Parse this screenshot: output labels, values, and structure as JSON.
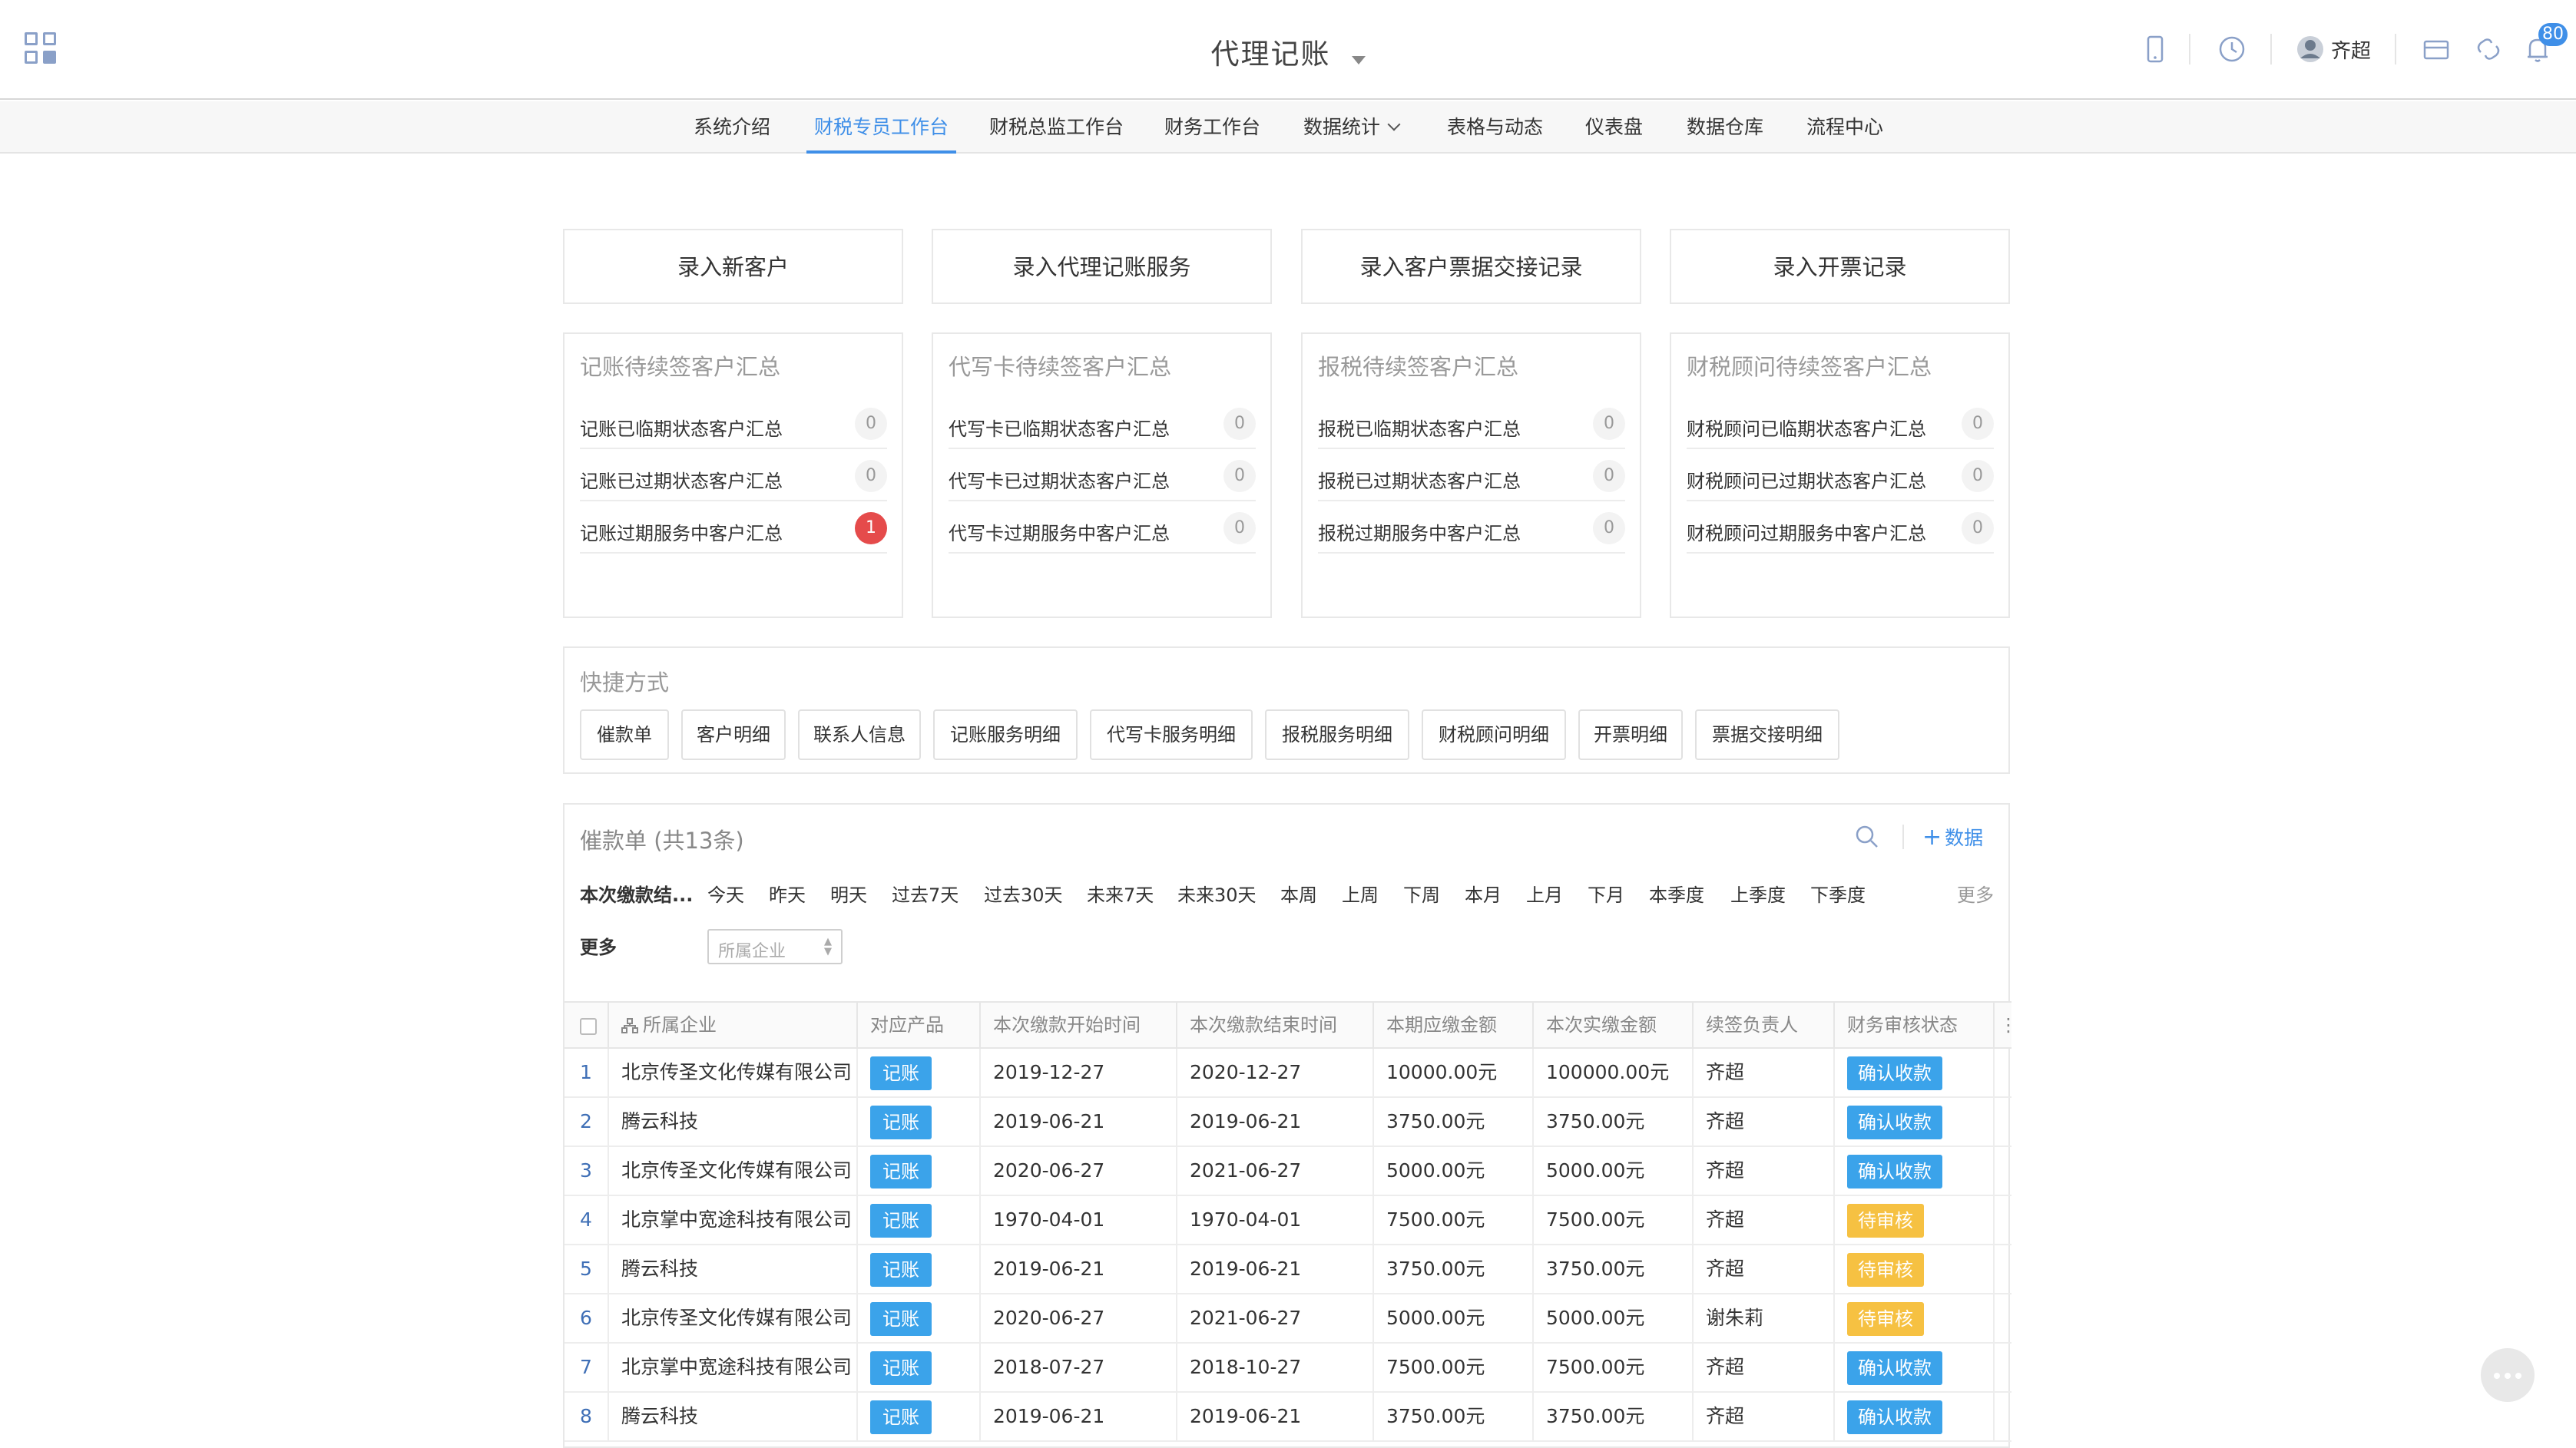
{
  "header": {
    "title": "代理记账",
    "user_name": "齐超",
    "notification_count": "80"
  },
  "nav": {
    "items": [
      "系统介绍",
      "财税专员工作台",
      "财税总监工作台",
      "财务工作台",
      "数据统计",
      "表格与动态",
      "仪表盘",
      "数据仓库",
      "流程中心"
    ],
    "active_index": 1
  },
  "actions": [
    "录入新客户",
    "录入代理记账服务",
    "录入客户票据交接记录",
    "录入开票记录"
  ],
  "summaries": [
    {
      "title": "记账待续签客户汇总",
      "rows": [
        {
          "label": "记账已临期状态客户汇总",
          "count": "0"
        },
        {
          "label": "记账已过期状态客户汇总",
          "count": "0"
        },
        {
          "label": "记账过期服务中客户汇总",
          "count": "1"
        }
      ]
    },
    {
      "title": "代写卡待续签客户汇总",
      "rows": [
        {
          "label": "代写卡已临期状态客户汇总",
          "count": "0"
        },
        {
          "label": "代写卡已过期状态客户汇总",
          "count": "0"
        },
        {
          "label": "代写卡过期服务中客户汇总",
          "count": "0"
        }
      ]
    },
    {
      "title": "报税待续签客户汇总",
      "rows": [
        {
          "label": "报税已临期状态客户汇总",
          "count": "0"
        },
        {
          "label": "报税已过期状态客户汇总",
          "count": "0"
        },
        {
          "label": "报税过期服务中客户汇总",
          "count": "0"
        }
      ]
    },
    {
      "title": "财税顾问待续签客户汇总",
      "rows": [
        {
          "label": "财税顾问已临期状态客户汇总",
          "count": "0"
        },
        {
          "label": "财税顾问已过期状态客户汇总",
          "count": "0"
        },
        {
          "label": "财税顾问过期服务中客户汇总",
          "count": "0"
        }
      ]
    }
  ],
  "shortcuts": {
    "title": "快捷方式",
    "items": [
      "催款单",
      "客户明细",
      "联系人信息",
      "记账服务明细",
      "代写卡服务明细",
      "报税服务明细",
      "财税顾问明细",
      "开票明细",
      "票据交接明细"
    ]
  },
  "list": {
    "title": "催款单 (共13条)",
    "add_label": "数据",
    "filter_label": "本次缴款结...",
    "date_options": [
      "今天",
      "昨天",
      "明天",
      "过去7天",
      "过去30天",
      "未来7天",
      "未来30天",
      "本周",
      "上周",
      "下周",
      "本月",
      "上月",
      "下月",
      "本季度",
      "上季度",
      "下季度"
    ],
    "filter_more": "更多",
    "more_label": "更多",
    "company_placeholder": "所属企业",
    "columns": [
      "所属企业",
      "对应产品",
      "本次缴款开始时间",
      "本次缴款结束时间",
      "本期应缴金额",
      "本次实缴金额",
      "续签负责人",
      "财务审核状态"
    ],
    "rows": [
      {
        "idx": "1",
        "company": "北京传圣文化传媒有限公司",
        "product": "记账",
        "start": "2019-12-27",
        "end": "2020-12-27",
        "due": "10000.00元",
        "paid": "100000.00元",
        "owner": "齐超",
        "status": "确认收款",
        "status_type": "confirmed"
      },
      {
        "idx": "2",
        "company": "腾云科技",
        "product": "记账",
        "start": "2019-06-21",
        "end": "2019-06-21",
        "due": "3750.00元",
        "paid": "3750.00元",
        "owner": "齐超",
        "status": "确认收款",
        "status_type": "confirmed"
      },
      {
        "idx": "3",
        "company": "北京传圣文化传媒有限公司",
        "product": "记账",
        "start": "2020-06-27",
        "end": "2021-06-27",
        "due": "5000.00元",
        "paid": "5000.00元",
        "owner": "齐超",
        "status": "确认收款",
        "status_type": "confirmed"
      },
      {
        "idx": "4",
        "company": "北京掌中宽途科技有限公司",
        "product": "记账",
        "start": "1970-04-01",
        "end": "1970-04-01",
        "due": "7500.00元",
        "paid": "7500.00元",
        "owner": "齐超",
        "status": "待审核",
        "status_type": "pending"
      },
      {
        "idx": "5",
        "company": "腾云科技",
        "product": "记账",
        "start": "2019-06-21",
        "end": "2019-06-21",
        "due": "3750.00元",
        "paid": "3750.00元",
        "owner": "齐超",
        "status": "待审核",
        "status_type": "pending"
      },
      {
        "idx": "6",
        "company": "北京传圣文化传媒有限公司",
        "product": "记账",
        "start": "2020-06-27",
        "end": "2021-06-27",
        "due": "5000.00元",
        "paid": "5000.00元",
        "owner": "谢朱莉",
        "status": "待审核",
        "status_type": "pending"
      },
      {
        "idx": "7",
        "company": "北京掌中宽途科技有限公司",
        "product": "记账",
        "start": "2018-07-27",
        "end": "2018-10-27",
        "due": "7500.00元",
        "paid": "7500.00元",
        "owner": "齐超",
        "status": "确认收款",
        "status_type": "confirmed"
      },
      {
        "idx": "8",
        "company": "腾云科技",
        "product": "记账",
        "start": "2019-06-21",
        "end": "2019-06-21",
        "due": "3750.00元",
        "paid": "3750.00元",
        "owner": "齐超",
        "status": "确认收款",
        "status_type": "confirmed"
      }
    ]
  },
  "colors": {
    "accent": "#3f8fe8",
    "product_tag": "#3ba3ea",
    "status_confirmed": "#3ba3ea",
    "status_pending": "#f6c142",
    "alert": "#e54b4b"
  },
  "icons": [
    "apps-grid-icon",
    "mobile-icon",
    "clock-icon",
    "avatar",
    "mail-icon",
    "link-icon",
    "bell-icon",
    "search-icon",
    "plus-icon",
    "more-icon",
    "org-icon"
  ]
}
